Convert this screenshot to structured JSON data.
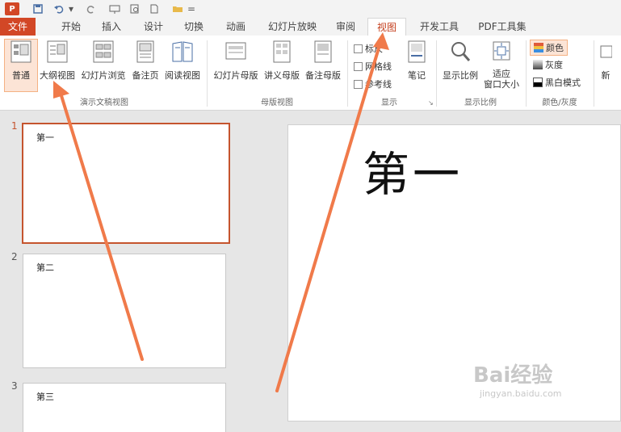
{
  "quick_access": {
    "logo": "P",
    "dropdown": "="
  },
  "tabs": [
    {
      "label": "文件"
    },
    {
      "label": "开始"
    },
    {
      "label": "插入"
    },
    {
      "label": "设计"
    },
    {
      "label": "切换"
    },
    {
      "label": "动画"
    },
    {
      "label": "幻灯片放映"
    },
    {
      "label": "审阅"
    },
    {
      "label": "视图"
    },
    {
      "label": "开发工具"
    },
    {
      "label": "PDF工具集"
    }
  ],
  "ribbon": {
    "presentation_views": {
      "label": "演示文稿视图",
      "buttons": [
        {
          "label": "普通"
        },
        {
          "label": "大纲视图"
        },
        {
          "label": "幻灯片浏览"
        },
        {
          "label": "备注页"
        },
        {
          "label": "阅读视图"
        }
      ]
    },
    "master_views": {
      "label": "母版视图",
      "buttons": [
        {
          "label": "幻灯片母版"
        },
        {
          "label": "讲义母版"
        },
        {
          "label": "备注母版"
        }
      ]
    },
    "show": {
      "label": "显示",
      "checks": [
        {
          "label": "标尺"
        },
        {
          "label": "网格线"
        },
        {
          "label": "参考线"
        }
      ],
      "notes": "笔记"
    },
    "zoom": {
      "label": "显示比例",
      "zoom_btn": "显示比例",
      "fit_line1": "适应",
      "fit_line2": "窗口大小"
    },
    "color": {
      "label": "颜色/灰度",
      "items": [
        {
          "label": "颜色"
        },
        {
          "label": "灰度"
        },
        {
          "label": "黑白模式"
        }
      ]
    },
    "new_window": "新"
  },
  "thumbnails": [
    {
      "num": "1",
      "text": "第一"
    },
    {
      "num": "2",
      "text": "第二"
    },
    {
      "num": "3",
      "text": "第三"
    }
  ],
  "slide": {
    "title": "第一"
  },
  "watermark": {
    "brand": "Bai经验",
    "url": "jingyan.baidu.com"
  },
  "colors": {
    "accent": "#d24726",
    "active_tab": "#c43e1c",
    "arrow": "#f07a4a"
  }
}
